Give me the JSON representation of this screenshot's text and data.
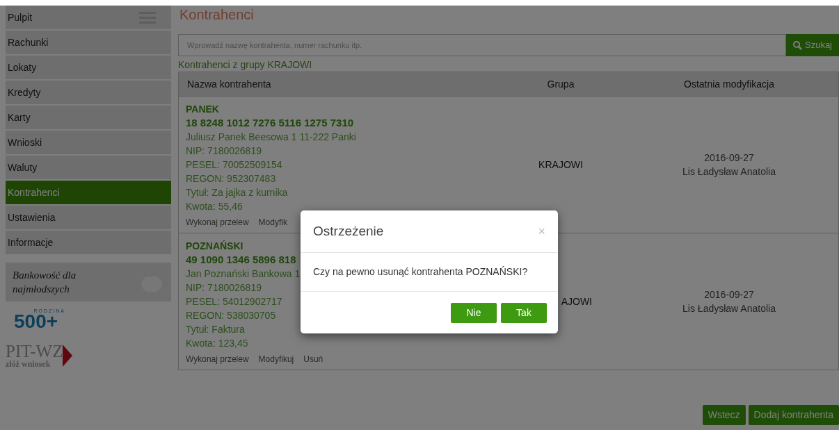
{
  "sidebar": {
    "items": [
      {
        "label": "Pulpit",
        "selected": false
      },
      {
        "label": "Rachunki",
        "selected": false
      },
      {
        "label": "Lokaty",
        "selected": false
      },
      {
        "label": "Kredyty",
        "selected": false
      },
      {
        "label": "Karty",
        "selected": false
      },
      {
        "label": "Wnioski",
        "selected": false
      },
      {
        "label": "Waluty",
        "selected": false
      },
      {
        "label": "Kontrahenci",
        "selected": true
      },
      {
        "label": "Ustawienia",
        "selected": false
      },
      {
        "label": "Informacje",
        "selected": false
      }
    ],
    "promo": "Bankowość dla najmłodszych",
    "logo_500": {
      "small": "RODZINA",
      "big": "500+"
    },
    "logo_pit": {
      "big": "PIT-WZ",
      "small": "złóż wniosek"
    }
  },
  "page": {
    "title": "Kontrahenci",
    "search": {
      "placeholder": "Wprowadź nazwę kontrahenta, numer rachunku itp.",
      "button": "Szukaj"
    },
    "group_label": "Kontrahenci z grupy KRAJOWI"
  },
  "table": {
    "columns": [
      "Nazwa kontrahenta",
      "Grupa",
      "Ostatnia modyfikacja"
    ],
    "rows": [
      {
        "name": "PANEK",
        "account": "18 8248 1012 7276 5116 1275 7310",
        "details": [
          "Juliusz Panek Beesowa 1 11-222 Panki",
          "NIP: 7180026819",
          "PESEL: 70052509154",
          "REGON: 952307483",
          "Tytuł: Za jajka z kurnika",
          "Kwota: 55,46"
        ],
        "actions": [
          "Wykonaj przelew",
          "Modyfik"
        ],
        "group": "KRAJOWI",
        "date": "2016-09-27",
        "author": "Lis Ładysław Anatolia"
      },
      {
        "name": "POZNAŃSKI",
        "account": "49 1090 1346 5896 818",
        "details": [
          "Jan Poznański Bankowa 1",
          "NIP: 7180026819",
          "PESEL: 54012902717",
          "REGON: 538030705",
          "Tytuł: Faktura",
          "Kwota: 123,45"
        ],
        "actions": [
          "Wykonaj przelew",
          "Modyfikuj",
          "Usuń"
        ],
        "group": "AJOWI",
        "date": "2016-09-27",
        "author": "Lis Ładysław Anatolia"
      }
    ]
  },
  "footer_buttons": [
    "Wstecz",
    "Dodaj kontrahenta"
  ],
  "dialog": {
    "title": "Ostrzeżenie",
    "close": "×",
    "message": "Czy na pewno usunąć kontrahenta POZNAŃSKI?",
    "buttons": [
      "Nie",
      "Tak"
    ]
  }
}
